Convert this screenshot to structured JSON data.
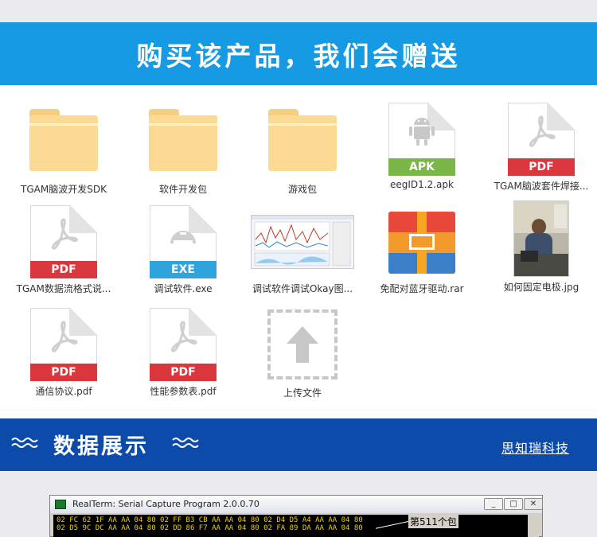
{
  "banner": {
    "title": "购买该产品，我们会赠送"
  },
  "files": [
    {
      "label": "TGAM脑波开发SDK",
      "type": "folder"
    },
    {
      "label": "软件开发包",
      "type": "folder"
    },
    {
      "label": "游戏包",
      "type": "folder"
    },
    {
      "label": "eegID1.2.apk",
      "type": "apk",
      "badge": "APK"
    },
    {
      "label": "TGAM脑波套件焊接...",
      "type": "pdf",
      "badge": "PDF"
    },
    {
      "label": "TGAM数据流格式说...",
      "type": "pdf",
      "badge": "PDF"
    },
    {
      "label": "调试软件.exe",
      "type": "exe",
      "badge": "EXE"
    },
    {
      "label": "调试软件调试Okay图...",
      "type": "image"
    },
    {
      "label": "免配对蓝牙驱动.rar",
      "type": "rar"
    },
    {
      "label": "如何固定电极.jpg",
      "type": "photo"
    },
    {
      "label": "通信协议.pdf",
      "type": "pdf",
      "badge": "PDF"
    },
    {
      "label": "性能参数表.pdf",
      "type": "pdf",
      "badge": "PDF"
    },
    {
      "label": "上传文件",
      "type": "upload"
    }
  ],
  "section": {
    "title": "数据展示",
    "company": "思知瑞科技"
  },
  "terminal": {
    "title": "RealTerm: Serial Capture Program 2.0.0.70",
    "line1": "02 FC 62 1F AA AA 04 80 02 FF B3 CB AA AA 04 80 02 D4 D5 A4 AA AA 04 80",
    "line2": "02 D5 9C DC AA AA 04 80 02 DD 86 F7 AA AA 04 80 02 FA 89 DA AA AA 04 80",
    "annotation": "第511个包",
    "buttons": {
      "minimize": "_",
      "maximize": "□",
      "close": "✕"
    }
  },
  "colors": {
    "banner": "#169ae4",
    "section": "#0d4bab",
    "pdf": "#d9363e",
    "apk": "#7ab648",
    "exe": "#2fa3dc"
  }
}
